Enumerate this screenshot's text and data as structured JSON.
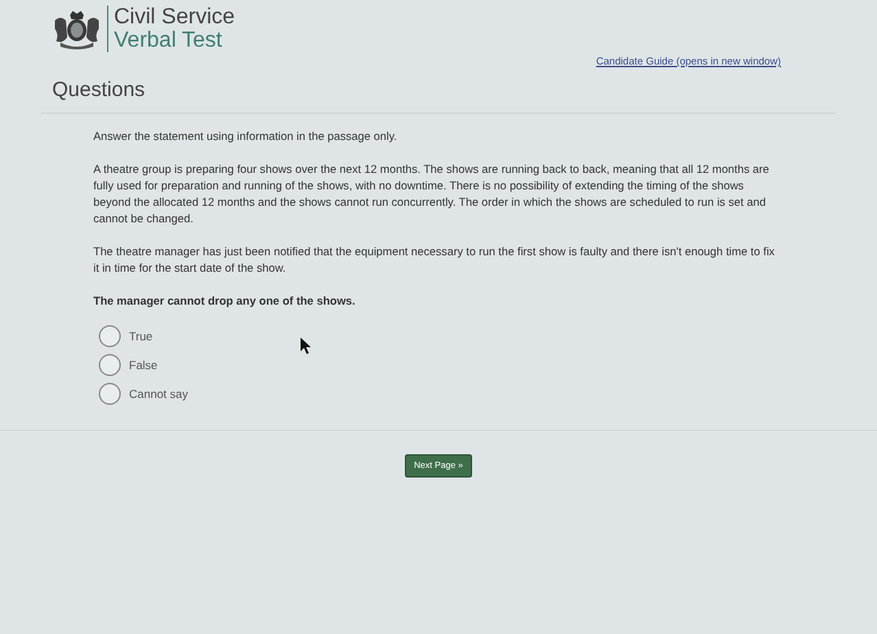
{
  "header": {
    "brand_line_1": "Civil Service",
    "brand_line_2": "Verbal Test",
    "guide_link": "Candidate Guide (opens in new window)"
  },
  "section_title": "Questions",
  "instruction": "Answer the statement using information in the passage only.",
  "passage": [
    "A theatre group is preparing four shows over the next 12 months. The shows are running back to back, meaning that all 12 months are fully used for preparation and running of the shows, with no downtime. There is no possibility of extending the timing of the shows beyond the allocated 12 months and the shows cannot run concurrently. The order in which the shows are scheduled to run is set and cannot be changed.",
    "The theatre manager has just been notified that the equipment necessary to run the first show is faulty and there isn't enough time to fix it in time for the start date of the show."
  ],
  "statement": "The manager cannot drop any one of the shows.",
  "options": [
    {
      "label": "True",
      "selected": false
    },
    {
      "label": "False",
      "selected": false
    },
    {
      "label": "Cannot say",
      "selected": false
    }
  ],
  "next_button": "Next Page »"
}
